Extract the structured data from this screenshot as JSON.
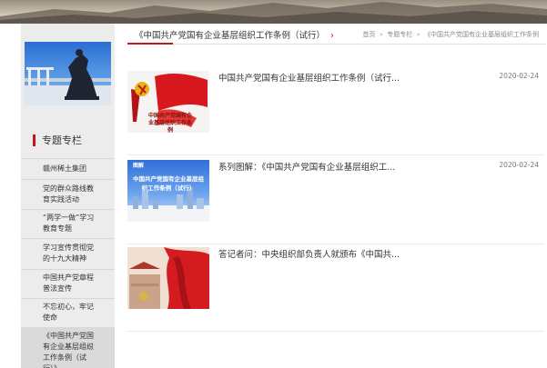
{
  "sidebar": {
    "section_title": "专题专栏",
    "items": [
      {
        "label": "赣州稀土集团"
      },
      {
        "label": "党的群众路线教育实践活动"
      },
      {
        "label": "“两学一做”学习教育专题"
      },
      {
        "label": "学习宣传贯彻党的十九大精神"
      },
      {
        "label": "中国共产党章程普法宣传"
      },
      {
        "label": "不忘初心，牢记使命"
      },
      {
        "label": "《中国共产党国有企业基层组织工作条例（试行）》"
      }
    ],
    "active_chevron": "›"
  },
  "section": {
    "title": "《中国共产党国有企业基层组织工作条例（试行）",
    "title_chevron": "›"
  },
  "breadcrumb": {
    "items": [
      "首页",
      "专题专栏",
      "《中国共产党国有企业基层组织工作条例"
    ],
    "separator": "»"
  },
  "articles": [
    {
      "title": "中国共产党国有企业基层组织工作条例（试行...",
      "date": "2020-02-24",
      "thumb_caption": "中国共产党国有企业基层组织工作条例"
    },
    {
      "title": "系列图解：《中国共产党国有企业基层组织工...",
      "date": "2020-02-24",
      "thumb_kicker": "图解",
      "thumb_caption": "中国共产党国有企业基层组织工作条例（试行）"
    },
    {
      "title": "答记者问：中央组织部负责人就颁布《中国共...",
      "date": "2020-02-24"
    }
  ],
  "colors": {
    "accent": "#c6161c",
    "sidebar_bg": "#ececec"
  }
}
